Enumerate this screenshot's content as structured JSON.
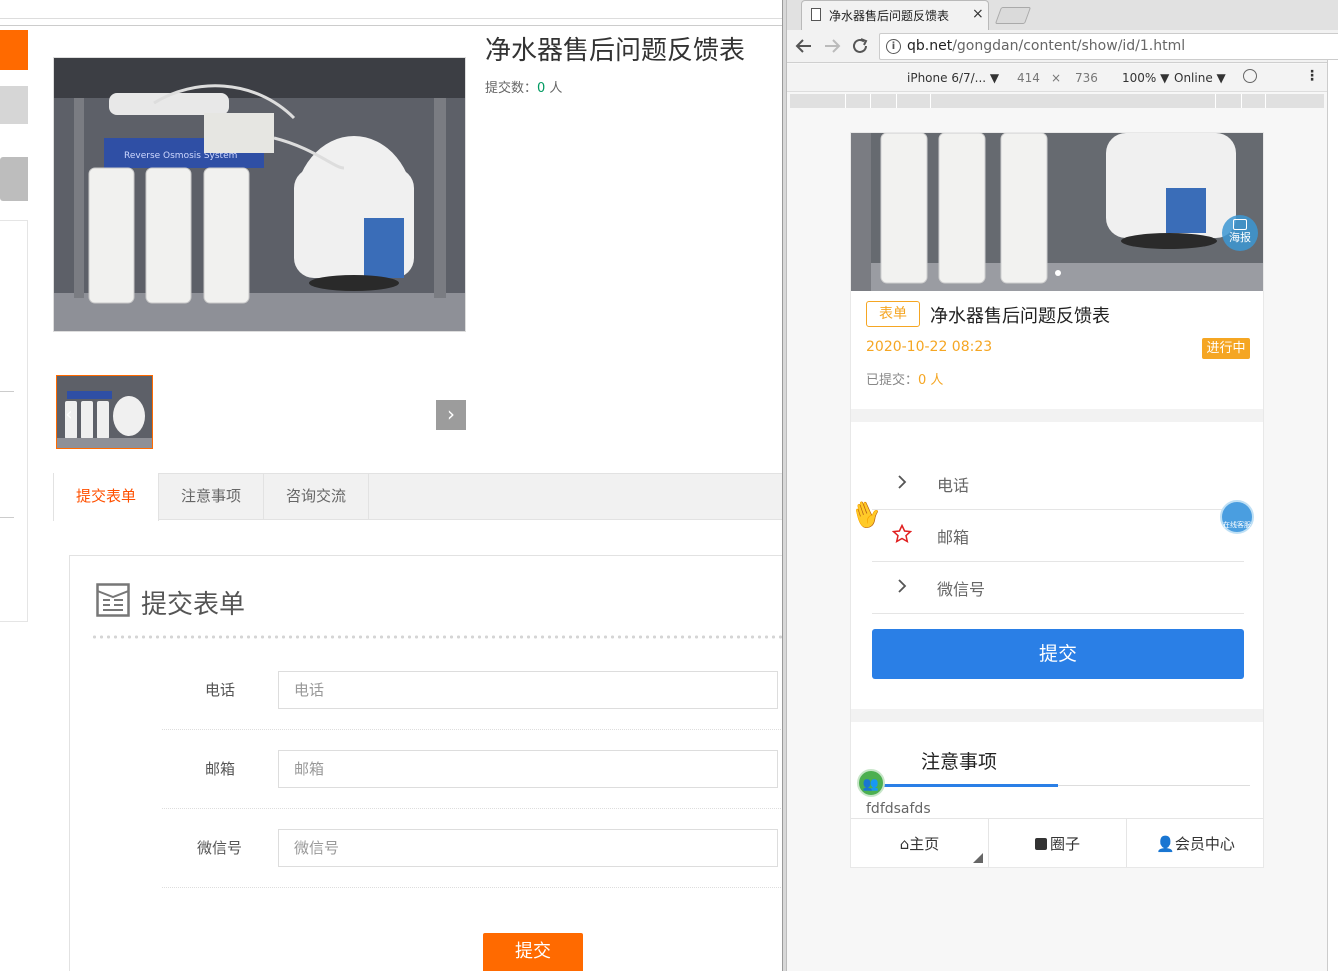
{
  "left_page": {
    "product_title": "净水器售后问题反馈表",
    "submit_count_label": "提交数：",
    "submit_count_value": "0",
    "submit_count_unit": " 人",
    "tabs": [
      {
        "label": "提交表单"
      },
      {
        "label": "注意事项"
      },
      {
        "label": "咨询交流"
      }
    ],
    "form_heading": "提交表单",
    "fields": [
      {
        "label": "电话",
        "placeholder": "电话"
      },
      {
        "label": "邮箱",
        "placeholder": "邮箱"
      },
      {
        "label": "微信号",
        "placeholder": "微信号"
      }
    ],
    "submit_label": "提交",
    "prev_arrow": "‹",
    "next_arrow": "›"
  },
  "browser": {
    "tab_title": "净水器售后问题反馈表",
    "tab_close": "×",
    "url_host": "qb.net",
    "url_path": "/gongdan/content/show/id/1.html",
    "device_name": "iPhone 6/7/... ▼",
    "width_value": "414",
    "times": "×",
    "height_value": "736",
    "zoom": "100% ▼",
    "throttle": "Online ▼"
  },
  "mobile": {
    "poster_label": "海报",
    "tag": "表单",
    "title": "净水器售后问题反馈表",
    "date": "2020-10-22 08:23",
    "status": "进行中",
    "count_label": "已提交：",
    "count_value": "0",
    "count_unit": " 人",
    "fields": [
      {
        "placeholder": "电话",
        "icon": "chevron-right-icon"
      },
      {
        "placeholder": "邮箱",
        "icon": "star-icon"
      },
      {
        "placeholder": "微信号",
        "icon": "chevron-right-icon"
      }
    ],
    "submit_label": "提交",
    "float_service_label": "在线客服",
    "notes_title": "注意事项",
    "notes_text": "fdfdsafds",
    "nav": [
      {
        "label": "主页",
        "icon": "home-icon"
      },
      {
        "label": "圈子",
        "icon": "rss-icon"
      },
      {
        "label": "会员中心",
        "icon": "user-icon"
      }
    ]
  },
  "colors": {
    "orange": "#ff6a00",
    "blue": "#2a7fe6",
    "amber": "#f5a623",
    "green": "#009a61"
  }
}
